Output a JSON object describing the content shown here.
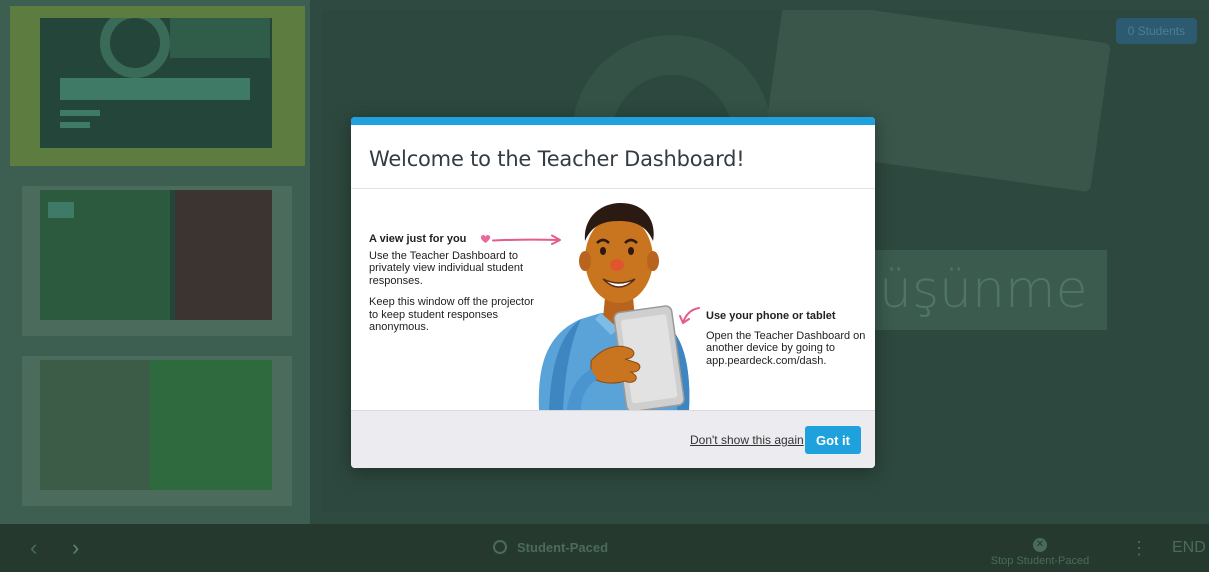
{
  "colors": {
    "accent": "#1ea1dc",
    "heart_pink": "#e8699b",
    "arrow_pink": "#e55b8f"
  },
  "background": {
    "stage_text": "üşünme",
    "students_button": "0 Students",
    "bottombar": {
      "prev_icon": "‹",
      "next_icon": "›",
      "student_paced_label": "Student-Paced",
      "stop_paced_label": "Stop Student-Paced",
      "more_icon": "⋮",
      "end_label": "END"
    }
  },
  "modal": {
    "title": "Welcome to the Teacher Dashboard!",
    "left": {
      "heading": "A view just for you",
      "paragraph1": "Use the Teacher Dashboard to privately view individual student responses.",
      "paragraph2": "Keep this window off the projector to keep student responses anonymous."
    },
    "right": {
      "heading": "Use your phone or tablet",
      "paragraph": "Open the Teacher Dashboard on another device by going to app.peardeck.com/dash."
    },
    "footer": {
      "dont_show_label": "Don't show this again",
      "got_it_label": "Got it"
    }
  }
}
